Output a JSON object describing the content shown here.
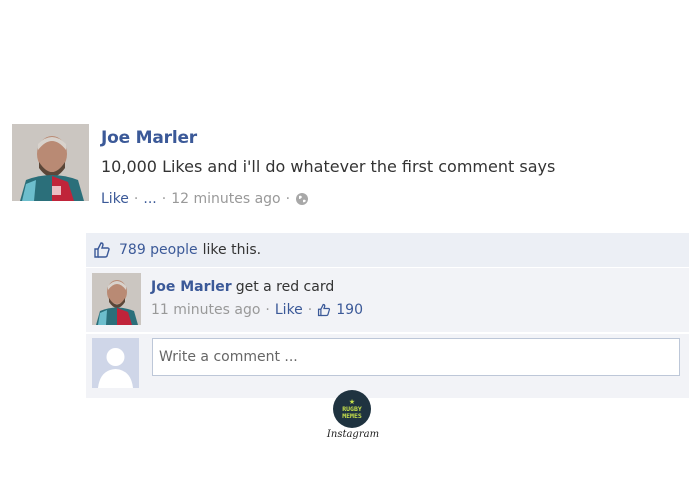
{
  "post": {
    "author": "Joe Marler",
    "text": "10,000 Likes and i'll do whatever the first comment says",
    "like_label": "Like",
    "ellipsis": "...",
    "time": "12 minutes ago",
    "separator": "·"
  },
  "likes": {
    "count_label": "789 people",
    "suffix": "like this."
  },
  "comment": {
    "author": "Joe Marler",
    "text": "get a red card",
    "time": "11 minutes ago",
    "like_label": "Like",
    "like_count": "190"
  },
  "composer": {
    "placeholder": "Write a comment ..."
  },
  "watermark": {
    "logo_line1": "RUGBY",
    "logo_line2": "MEMES",
    "logo_star": "★",
    "caption": "Instagram"
  },
  "colors": {
    "link": "#3b5998",
    "likes_bg": "#eceff5",
    "logo_bg": "#1f3340",
    "logo_fg": "#c7e04b"
  }
}
